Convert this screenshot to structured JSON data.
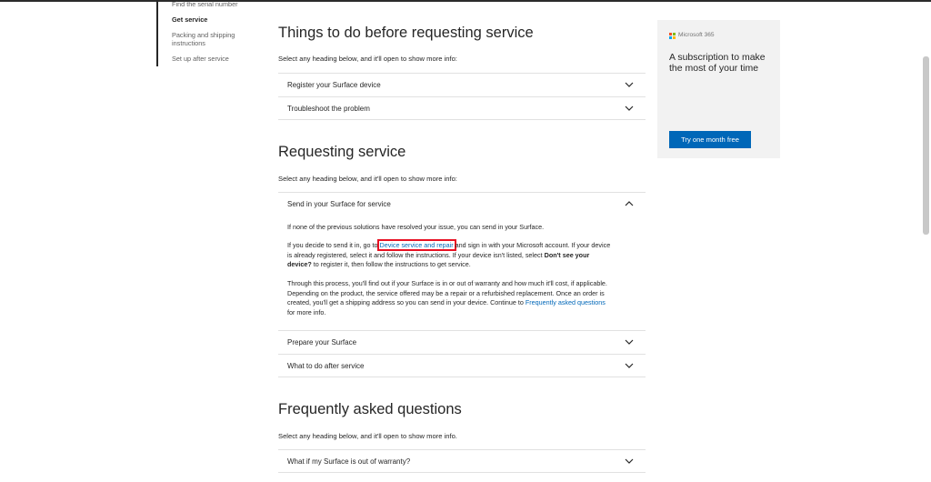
{
  "leftnav": {
    "items": [
      {
        "label": "Find the serial number",
        "active": false
      },
      {
        "label": "Get service",
        "active": true
      },
      {
        "label": "Packing and shipping instructions",
        "active": false
      },
      {
        "label": "Set up after service",
        "active": false
      }
    ]
  },
  "sections": {
    "before": {
      "title": "Things to do before requesting service",
      "hint": "Select any heading below, and it'll open to show more info:",
      "items": [
        "Register your Surface device",
        "Troubleshoot the problem"
      ]
    },
    "requesting": {
      "title": "Requesting service",
      "hint": "Select any heading below, and it'll open to show more info:",
      "expanded_label": "Send in your Surface for service",
      "panel": {
        "p1": "If none of the previous solutions have resolved your issue, you can send in your Surface.",
        "p2_a": "If you decide to send it in, go to ",
        "p2_link": "Device service and repair",
        "p2_b": " and sign in with your Microsoft account. If your device is already registered, select it and follow the instructions. If your device isn't listed, select ",
        "p2_bold": "Don't see your device?",
        "p2_c": " to register it, then follow the instructions to get service.",
        "p3_a": "Through this process, you'll find out if your Surface is in or out of warranty and how much it'll cost, if applicable. Depending on the product, the service offered may be a repair or a refurbished replacement. Once an order is created, you'll get a shipping address so you can send in your device. Continue to ",
        "p3_link": "Frequently asked questions",
        "p3_b": " for more info."
      },
      "items": [
        "Prepare your Surface",
        "What to do after service"
      ]
    },
    "faq": {
      "title": "Frequently asked questions",
      "hint": "Select any heading below, and it'll open to show more info.",
      "items": [
        "What if my Surface is out of warranty?"
      ]
    }
  },
  "ad": {
    "brand": "Microsoft 365",
    "text": "A subscription to make the most of your time",
    "button": "Try one month free"
  },
  "colors": {
    "accent": "#0067b8",
    "highlight": "#e81123"
  }
}
